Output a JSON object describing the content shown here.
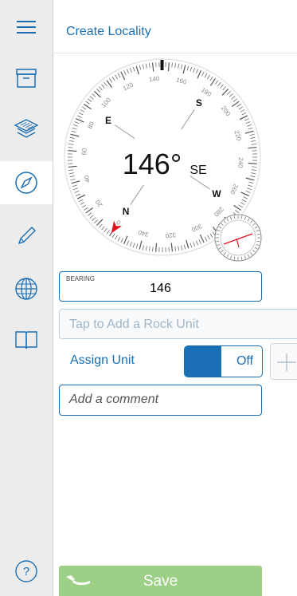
{
  "header": {
    "title": "Create Locality"
  },
  "sidebar": {
    "items": [
      {
        "icon": "menu-icon"
      },
      {
        "icon": "archive-box-icon"
      },
      {
        "icon": "layers-icon"
      },
      {
        "icon": "compass-icon",
        "active": true
      },
      {
        "icon": "pencil-icon"
      },
      {
        "icon": "globe-icon"
      },
      {
        "icon": "book-icon"
      },
      {
        "icon": "help-icon",
        "glyph": "?"
      }
    ]
  },
  "compass": {
    "heading": "146°",
    "heading_dir": "SE",
    "cardinals": {
      "n": "N",
      "e": "E",
      "s": "S",
      "w": "W"
    },
    "degree_labels": [
      "0",
      "20",
      "40",
      "60",
      "80",
      "100",
      "120",
      "140",
      "160",
      "180",
      "200",
      "220",
      "240",
      "260",
      "280",
      "300",
      "320",
      "340"
    ]
  },
  "form": {
    "bearing_label": "BEARING",
    "bearing_value": "146",
    "rock_unit_placeholder": "Tap to Add a Rock Unit",
    "assign_unit_label": "Assign Unit",
    "toggle_state": "Off",
    "comment_placeholder": "Add a comment"
  },
  "footer": {
    "save_label": "Save"
  },
  "colors": {
    "accent": "#1a6fb4",
    "save": "#9dd087",
    "needle": "#e8101b"
  }
}
